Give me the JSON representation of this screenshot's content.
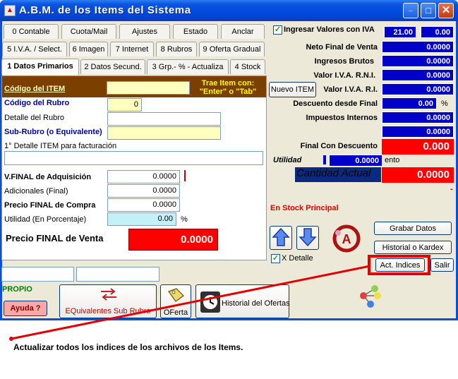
{
  "window": {
    "title": "A.B.M. de los Items del Sistema",
    "icon": "app-icon",
    "controls": {
      "minimize": "_",
      "maximize": "□",
      "close": "✕"
    }
  },
  "tabs_row1": [
    "0 Contable",
    "Cuota/Mail",
    "Ajustes",
    "Estado",
    "Anclar"
  ],
  "tabs_row2": [
    "5 I.V.A. / Select.",
    "6 Imagen",
    "7 Internet",
    "8 Rubros",
    "9 Oferta Gradual"
  ],
  "tabs_row3": [
    "1 Datos Primarios",
    "2 Datos Secund.",
    "3 Grp.- % - Actualiza",
    "4 Stock"
  ],
  "form": {
    "codigo_item_label": "Código del ITEM",
    "codigo_item_value": "",
    "trae_item_hint": "Trae Item con: \"Enter\" o \"Tab\"",
    "codigo_rubro_label": "Código del Rubro",
    "codigo_rubro_value": "0",
    "detalle_rubro_label": "Detalle del Rubro",
    "detalle_rubro_value": "",
    "subrubro_label": "Sub-Rubro (o Equivalente)",
    "subrubro_value": "",
    "detalle_item_label": "1° Detalle ITEM para facturación",
    "detalle_item_value": "",
    "vfinal_adq_label": "V.FINAL de Adquisición",
    "vfinal_adq_value": "0.0000",
    "adicionales_label": "Adicionales (Final)",
    "adicionales_value": "0.0000",
    "precio_compra_label": "Precio FINAL de Compra",
    "precio_compra_value": "0.0000",
    "utilidad_label": "Utilidad (En Porcentaje)",
    "utilidad_value": "0.00",
    "percent": "%",
    "precio_venta_label": "Precio FINAL de  Venta",
    "precio_venta_value": "0.0000"
  },
  "right": {
    "ingresar_iva_label": "Ingresar Valores con IVA",
    "iva_rate": "21.00",
    "iva_other": "0.00",
    "neto_final_label": "Neto Final de Venta",
    "neto_final_value": "0.0000",
    "ingresos_brutos_label": "Ingresos Brutos",
    "ingresos_brutos_value": "0.0000",
    "iva_rni_label": "Valor I.V.A. R.N.I.",
    "iva_rni_value": "0.0000",
    "nuevo_item_label": "Nuevo ITEM",
    "iva_ri_label": "Valor I.V.A. R.I.",
    "iva_ri_value": "0.0000",
    "descuento_label": "Descuento desde Final",
    "descuento_value": "0.00",
    "descuento_pct": "%",
    "impuestos_label": "Impuestos Internos",
    "impuestos_value": "0.0000",
    "extra_value": "0.0000",
    "final_descuento_label": "Final Con Descuento",
    "final_descuento_value": "0.000",
    "utilidad_label": "Utilidad",
    "utilidad_value": "0.0000",
    "utilidad_suffix": "ento",
    "cantidad_label": "Cantidad Actual",
    "cantidad_value": "0.0000",
    "dash": "-",
    "stock_label": "En Stock Principal",
    "grabar_label": "Grabar Datos",
    "historial_label": "Historial o Kardex",
    "xdetalle_label": "X Detalle",
    "act_indices_label": "Act. Indices",
    "salir_label": "Salir"
  },
  "bottom": {
    "propio_label": "PROPIO",
    "ayuda_label": "Ayuda ?",
    "equivalentes_label": "EQuivalentes Sub Rubro",
    "oferta_label": "OFerta",
    "historial_ofertas_label": "Historial del Ofertas"
  },
  "annotation": "Actualizar todos los indices de los archivos de los Items.",
  "colors": {
    "title_blue": "#0046d8",
    "field_blue": "#0000c8",
    "alert_red": "#ff0000",
    "brown_header": "#7b3f00",
    "annotation_red": "#e00000"
  }
}
